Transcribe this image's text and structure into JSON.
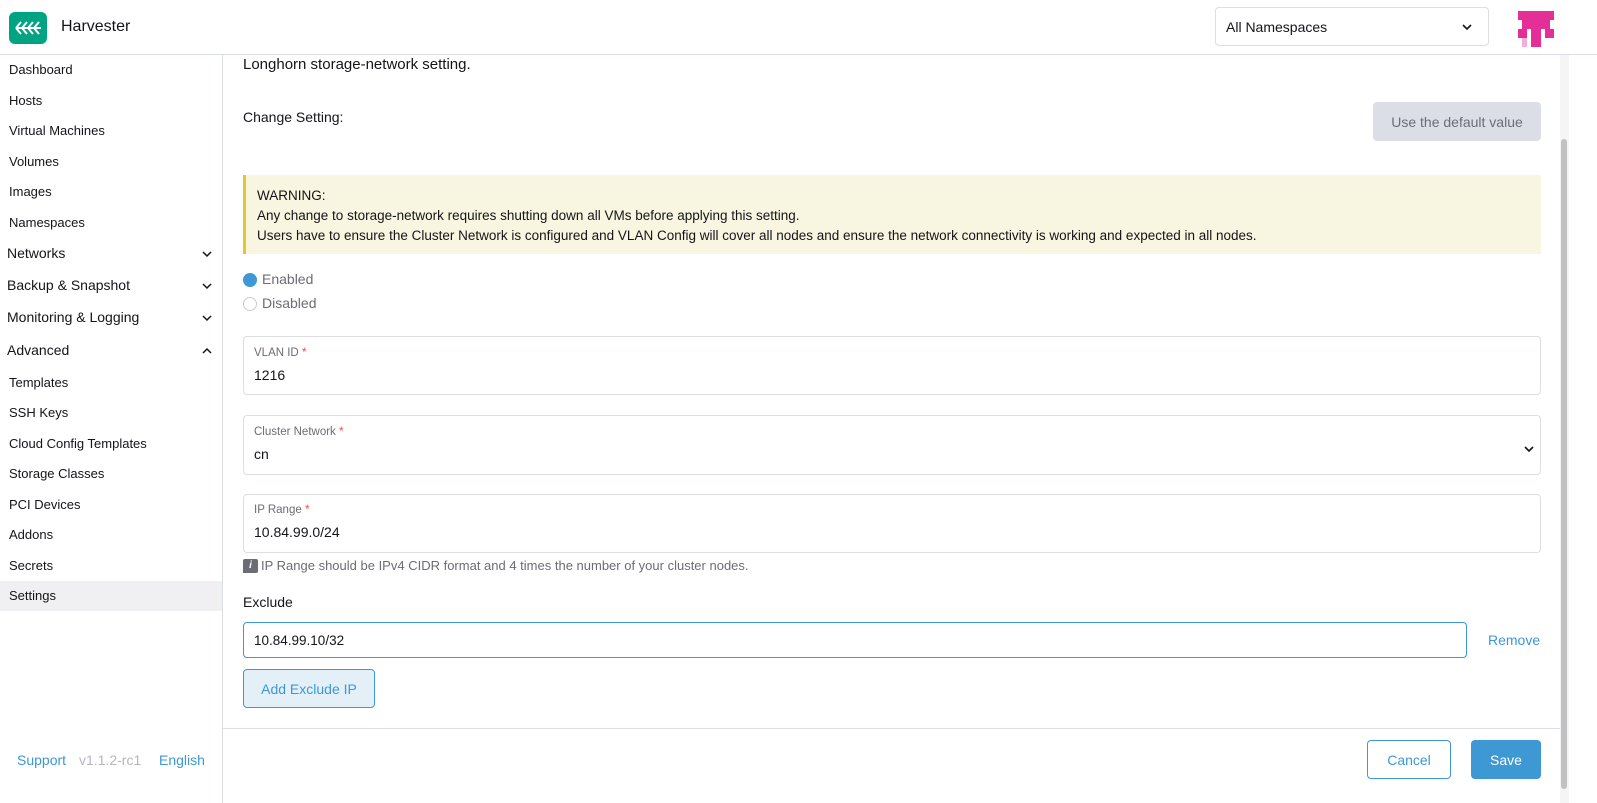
{
  "header": {
    "app_title": "Harvester",
    "namespace_select": "All Namespaces",
    "brand_color": "#00a483",
    "avatar_color": "#e62e98"
  },
  "sidebar": {
    "items": [
      {
        "label": "Dashboard"
      },
      {
        "label": "Hosts"
      },
      {
        "label": "Virtual Machines"
      },
      {
        "label": "Volumes"
      },
      {
        "label": "Images"
      },
      {
        "label": "Namespaces"
      }
    ],
    "groups": [
      {
        "label": "Networks",
        "expanded": false
      },
      {
        "label": "Backup & Snapshot",
        "expanded": false
      },
      {
        "label": "Monitoring & Logging",
        "expanded": false
      },
      {
        "label": "Advanced",
        "expanded": true
      }
    ],
    "advanced_items": [
      {
        "label": "Templates"
      },
      {
        "label": "SSH Keys"
      },
      {
        "label": "Cloud Config Templates"
      },
      {
        "label": "Storage Classes"
      },
      {
        "label": "PCI Devices"
      },
      {
        "label": "Addons"
      },
      {
        "label": "Secrets"
      },
      {
        "label": "Settings",
        "active": true
      }
    ],
    "footer": {
      "support": "Support",
      "version": "v1.1.2-rc1",
      "language": "English"
    }
  },
  "main": {
    "description": "Longhorn storage-network setting.",
    "change_setting_label": "Change Setting:",
    "default_button": "Use the default value",
    "warning": {
      "title": "WARNING:",
      "line1": "Any change to storage-network requires shutting down all VMs before applying this setting.",
      "line2": "Users have to ensure the Cluster Network is configured and VLAN Config will cover all nodes and ensure the network connectivity is working and expected in all nodes."
    },
    "radio_enabled": "Enabled",
    "radio_disabled": "Disabled",
    "selected_radio": "Enabled",
    "vlan": {
      "label": "VLAN ID",
      "value": "1216"
    },
    "cluster_network": {
      "label": "Cluster Network",
      "value": "cn"
    },
    "ip_range": {
      "label": "IP Range",
      "value": "10.84.99.0/24"
    },
    "required_mark": "*",
    "ip_range_hint": "IP Range should be IPv4 CIDR format and 4 times the number of your cluster nodes.",
    "exclude_label": "Exclude",
    "exclude_value": "10.84.99.10/32",
    "remove_link": "Remove",
    "add_exclude_button": "Add Exclude IP",
    "cancel_button": "Cancel",
    "save_button": "Save"
  }
}
